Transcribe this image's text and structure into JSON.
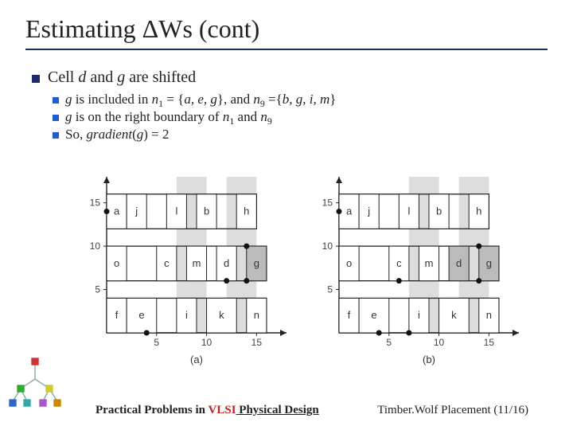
{
  "title": "Estimating ΔWs (cont)",
  "main_bullet": {
    "pre": "Cell ",
    "d": "d",
    "mid": " and ",
    "g": "g",
    "post": " are shifted"
  },
  "sub_bullets": [
    {
      "g": "g",
      "t1": " is included in ",
      "n1": "n",
      "s1": "1",
      "t2": " = {",
      "set1": "a, e, g",
      "t3": "}, and ",
      "n2": "n",
      "s2": "9",
      "t4": " ={",
      "set2": "b, g, i, m",
      "t5": "}"
    },
    {
      "g": "g",
      "t1": " is on the right boundary of ",
      "n1": "n",
      "s1": "1",
      "t2": " and ",
      "n2": "n",
      "s2": "9"
    },
    {
      "t1": "So, ",
      "grad": "gradient",
      "t2": "(",
      "g": "g",
      "t3": ") = 2"
    }
  ],
  "axis_ticks": {
    "x": [
      "5",
      "10",
      "15"
    ],
    "y": [
      "5",
      "10",
      "15"
    ]
  },
  "captions": {
    "a": "(a)",
    "b": "(b)"
  },
  "chart_data": [
    {
      "type": "diagram",
      "caption": "(a)",
      "x_range": [
        0,
        18
      ],
      "y_range": [
        0,
        18
      ],
      "xticks": [
        5,
        10,
        15
      ],
      "yticks": [
        5,
        10,
        15
      ],
      "shaded_columns": [
        [
          7,
          10
        ],
        [
          12,
          15
        ]
      ],
      "rows": [
        {
          "y": [
            12,
            16
          ],
          "cells": [
            {
              "x": [
                0,
                2
              ],
              "label": "a",
              "dot_left": true
            },
            {
              "x": [
                2,
                4
              ],
              "label": "j"
            },
            {
              "x": [
                6,
                8
              ],
              "label": "l"
            },
            {
              "x": [
                9,
                11
              ],
              "label": "b"
            },
            {
              "x": [
                13,
                15
              ],
              "label": "h"
            }
          ]
        },
        {
          "y": [
            6,
            10
          ],
          "cells": [
            {
              "x": [
                0,
                2
              ],
              "label": "o"
            },
            {
              "x": [
                5,
                7
              ],
              "label": "c"
            },
            {
              "x": [
                8,
                10
              ],
              "label": "m"
            },
            {
              "x": [
                11,
                13
              ],
              "label": "d",
              "dots": [
                [
                  12,
                  6
                ]
              ]
            },
            {
              "x": [
                14,
                16
              ],
              "label": "g",
              "highlight": true,
              "dots": [
                [
                  14,
                  6
                ],
                [
                  14,
                  10
                ]
              ]
            }
          ]
        },
        {
          "y": [
            0,
            4
          ],
          "cells": [
            {
              "x": [
                0,
                2
              ],
              "label": "f"
            },
            {
              "x": [
                2,
                5
              ],
              "label": "e",
              "dots": [
                [
                  4,
                  0
                ]
              ]
            },
            {
              "x": [
                7,
                9
              ],
              "label": "i"
            },
            {
              "x": [
                10,
                13
              ],
              "label": "k"
            },
            {
              "x": [
                14,
                16
              ],
              "label": "n"
            }
          ]
        }
      ]
    },
    {
      "type": "diagram",
      "caption": "(b)",
      "x_range": [
        0,
        18
      ],
      "y_range": [
        0,
        18
      ],
      "xticks": [
        5,
        10,
        15
      ],
      "yticks": [
        5,
        10,
        15
      ],
      "shaded_columns": [
        [
          7,
          10
        ],
        [
          12,
          15
        ]
      ],
      "rows": [
        {
          "y": [
            12,
            16
          ],
          "cells": [
            {
              "x": [
                0,
                2
              ],
              "label": "a",
              "dot_left": true
            },
            {
              "x": [
                2,
                4
              ],
              "label": "j"
            },
            {
              "x": [
                6,
                8
              ],
              "label": "l"
            },
            {
              "x": [
                9,
                11
              ],
              "label": "b"
            },
            {
              "x": [
                13,
                15
              ],
              "label": "h"
            }
          ]
        },
        {
          "y": [
            6,
            10
          ],
          "cells": [
            {
              "x": [
                0,
                2
              ],
              "label": "o"
            },
            {
              "x": [
                5,
                7
              ],
              "label": "c",
              "dots": [
                [
                  6,
                  6
                ]
              ]
            },
            {
              "x": [
                8,
                10
              ],
              "label": "m"
            },
            {
              "x": [
                11,
                13
              ],
              "label": "d",
              "highlight": true
            },
            {
              "x": [
                14,
                16
              ],
              "label": "g",
              "highlight": true,
              "dots": [
                [
                  14,
                  6
                ],
                [
                  14,
                  10
                ]
              ]
            }
          ]
        },
        {
          "y": [
            0,
            4
          ],
          "cells": [
            {
              "x": [
                0,
                2
              ],
              "label": "f"
            },
            {
              "x": [
                2,
                5
              ],
              "label": "e",
              "dots": [
                [
                  4,
                  0
                ]
              ]
            },
            {
              "x": [
                7,
                9
              ],
              "label": "i",
              "dots": [
                [
                  7,
                  0
                ]
              ]
            },
            {
              "x": [
                10,
                13
              ],
              "label": "k"
            },
            {
              "x": [
                14,
                16
              ],
              "label": "n"
            }
          ]
        }
      ]
    }
  ],
  "footer": {
    "left_pre": "Practical Problems in ",
    "left_vlsi": "VLSI",
    "left_phys": " Physical Design",
    "right": "Timber.Wolf Placement (11/16)"
  }
}
